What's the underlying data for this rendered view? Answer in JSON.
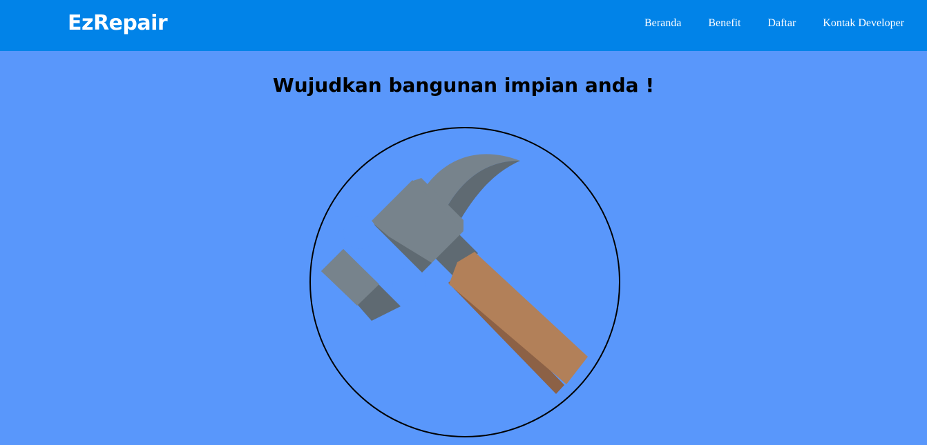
{
  "navbar": {
    "brand": "EzRepair",
    "links": [
      "Beranda",
      "Benefit",
      "Daftar",
      "Kontak Developer"
    ]
  },
  "hero": {
    "headline": "Wujudkan bangunan impian anda !",
    "image_icon": "hammer-icon"
  },
  "colors": {
    "navbar_bg": "#0183e8",
    "page_bg": "#5997fb",
    "hammer_head": "#77838c",
    "hammer_head_shadow": "#5f6a72",
    "handle": "#b28059",
    "handle_shadow": "#8c6146"
  }
}
